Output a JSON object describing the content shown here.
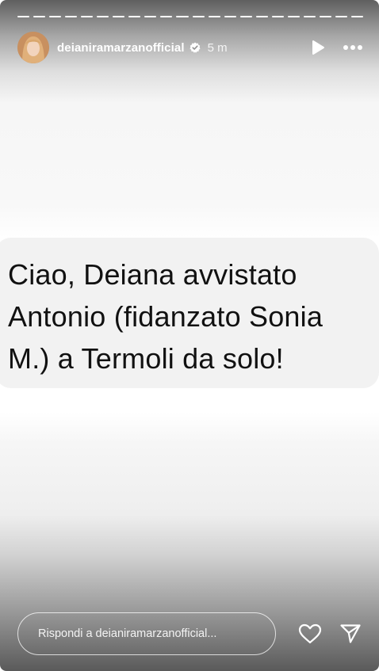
{
  "story": {
    "segments": 22,
    "active_segment": 21
  },
  "header": {
    "username": "deianiramarzanofficial",
    "time": "5 m",
    "verified_icon": "verified-badge-icon",
    "play_icon": "play-icon",
    "more_icon": "more-options-icon"
  },
  "message": {
    "text": "Ciao, Deiana avvistato Antonio (fidanzato Sonia M.) a Termoli da solo!"
  },
  "footer": {
    "reply_placeholder": "Rispondi a deianiramarzanofficial...",
    "like_icon": "heart-icon",
    "share_icon": "send-icon"
  }
}
